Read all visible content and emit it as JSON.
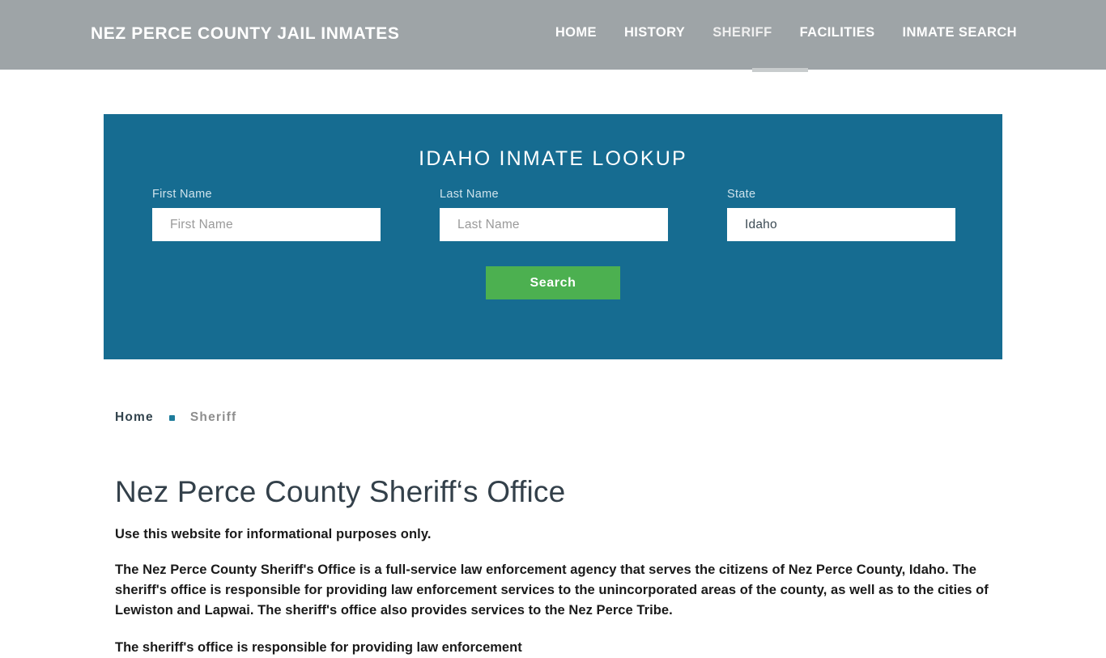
{
  "header": {
    "brand": "Nez Perce County Jail Inmates",
    "nav": [
      {
        "label": "Home",
        "active": false
      },
      {
        "label": "History",
        "active": false
      },
      {
        "label": "Sheriff",
        "active": true
      },
      {
        "label": "Facilities",
        "active": false
      },
      {
        "label": "Inmate Search",
        "active": false
      }
    ],
    "background_color": "#9ea4a7",
    "active_indicator_color": "#c8cccd"
  },
  "lookup": {
    "title": "Idaho Inmate Lookup",
    "panel_color": "#166c91",
    "fields": {
      "first_name": {
        "label": "First Name",
        "placeholder": "First Name",
        "value": ""
      },
      "last_name": {
        "label": "Last Name",
        "placeholder": "Last Name",
        "value": ""
      },
      "state": {
        "label": "State",
        "placeholder": "State",
        "value": "Idaho"
      }
    },
    "search_button": {
      "label": "Search",
      "color": "#4cb050"
    }
  },
  "breadcrumb": {
    "home": "Home",
    "separator_color": "#1e7c9b",
    "current": "Sheriff"
  },
  "main": {
    "title": "Nez Perce County Sheriff‘s Office",
    "lede": "Use this website for informational purposes only.",
    "paragraph_1": "The Nez Perce County Sheriff's Office is a full-service law enforcement agency that serves the citizens of Nez Perce County, Idaho. The sheriff's office is responsible for providing law enforcement services to the unincorporated areas of the county, as well as to the cities of Lewiston and Lapwai. The sheriff's office also provides services to the Nez Perce Tribe.",
    "paragraph_2_clipped": "The sheriff's office is responsible for providing law enforcement"
  }
}
